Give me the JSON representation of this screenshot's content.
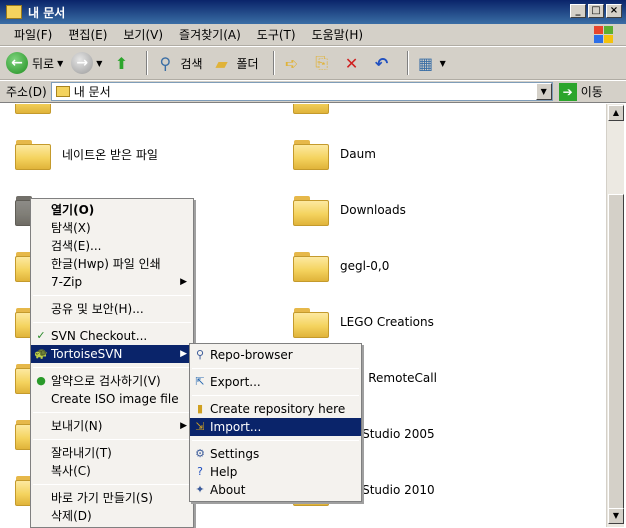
{
  "window": {
    "title": "내 문서"
  },
  "menubar": {
    "items": [
      "파일(F)",
      "편집(E)",
      "보기(V)",
      "즐겨찾기(A)",
      "도구(T)",
      "도움말(H)"
    ]
  },
  "toolbar": {
    "back_label": "뒤로",
    "search_label": "검색",
    "folders_label": "폴더"
  },
  "addressbar": {
    "label": "주소(D)",
    "value": "내 문서",
    "go_label": "이동"
  },
  "files_left": [
    {
      "name": "네이트온 받은 파일"
    }
  ],
  "files_right": [
    {
      "name": "Daum"
    },
    {
      "name": "Downloads"
    },
    {
      "name": "gegl-0,0"
    },
    {
      "name": "LEGO Creations"
    },
    {
      "name": "eOn RemoteCall"
    },
    {
      "name": "ual Studio 2005"
    },
    {
      "name": "ual Studio 2010"
    }
  ],
  "context_menu": {
    "items": [
      {
        "label": "열기(O)",
        "bold": true
      },
      {
        "label": "탐색(X)"
      },
      {
        "label": "검색(E)..."
      },
      {
        "label": "한글(Hwp) 파일 인쇄"
      },
      {
        "label": "7-Zip",
        "submenu": true
      },
      {
        "sep": true
      },
      {
        "label": "공유 및 보안(H)..."
      },
      {
        "sep": true
      },
      {
        "label": "SVN Checkout...",
        "icon": "svn-checkout-icon"
      },
      {
        "label": "TortoiseSVN",
        "icon": "tortoisesvn-icon",
        "submenu": true,
        "selected": true
      },
      {
        "sep": true
      },
      {
        "label": "알약으로 검사하기(V)",
        "icon": "alyac-icon"
      },
      {
        "label": "Create ISO image file"
      },
      {
        "sep": true
      },
      {
        "label": "보내기(N)",
        "submenu": true
      },
      {
        "sep": true
      },
      {
        "label": "잘라내기(T)"
      },
      {
        "label": "복사(C)"
      },
      {
        "sep": true
      },
      {
        "label": "바로 가기 만들기(S)"
      },
      {
        "label": "삭제(D)"
      }
    ]
  },
  "submenu": {
    "items": [
      {
        "label": "Repo-browser",
        "icon": "repo-browser-icon"
      },
      {
        "sep": true
      },
      {
        "label": "Export...",
        "icon": "export-icon"
      },
      {
        "sep": true
      },
      {
        "label": "Create repository here",
        "icon": "create-repo-icon"
      },
      {
        "label": "Import...",
        "icon": "import-icon",
        "selected": true
      },
      {
        "sep": true
      },
      {
        "label": "Settings",
        "icon": "settings-icon"
      },
      {
        "label": "Help",
        "icon": "help-icon"
      },
      {
        "label": "About",
        "icon": "about-icon"
      }
    ]
  }
}
